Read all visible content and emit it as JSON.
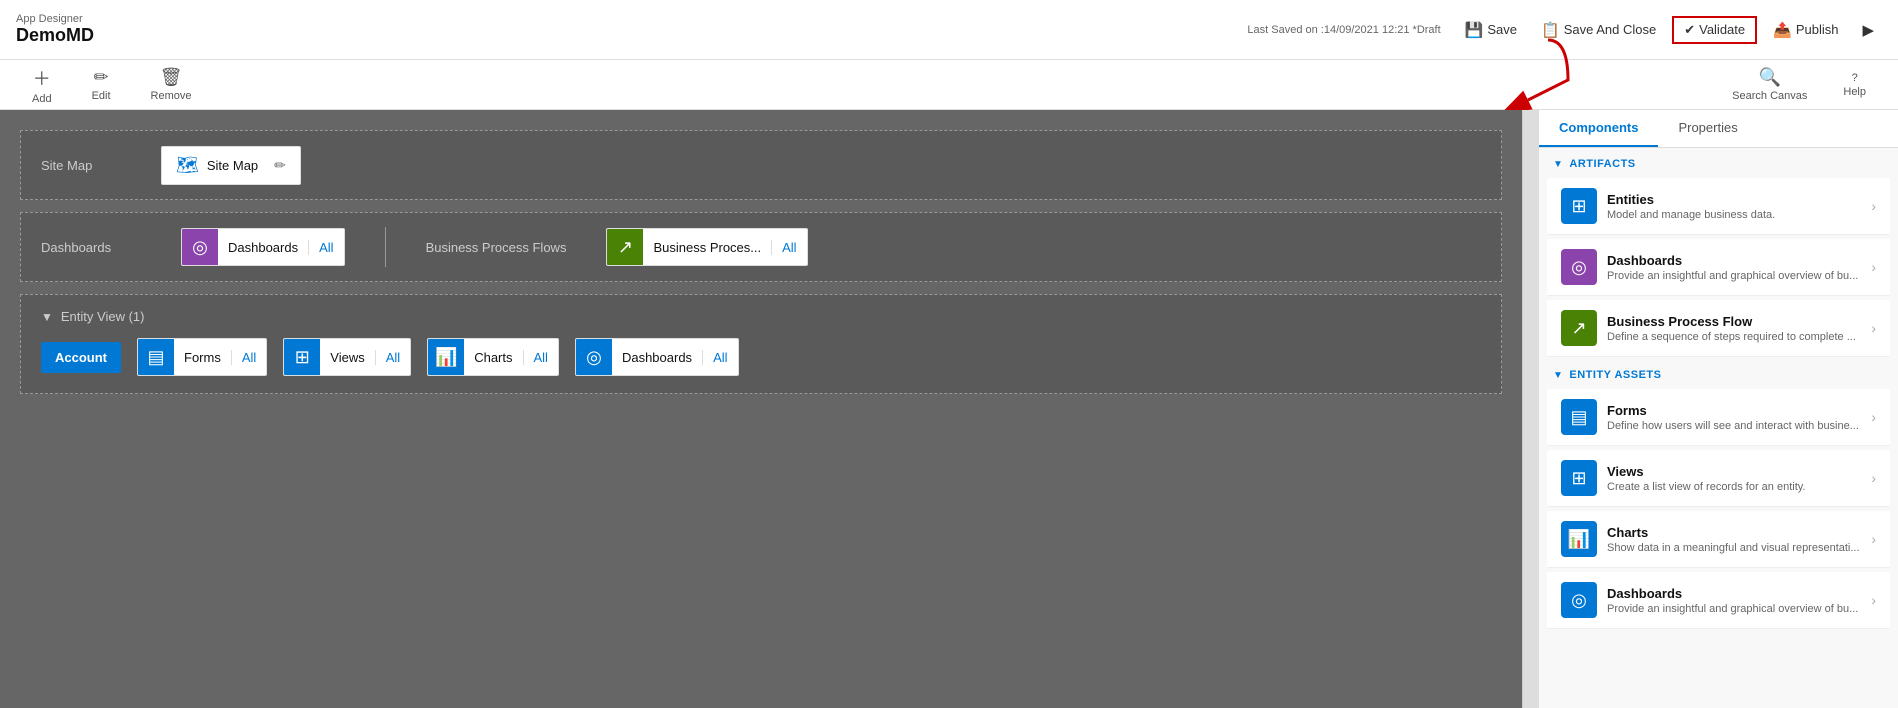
{
  "app": {
    "designer_label": "App Designer",
    "app_name": "DemoMD"
  },
  "header": {
    "last_saved": "Last Saved on :14/09/2021 12:21 *Draft",
    "save_label": "Save",
    "save_close_label": "Save And Close",
    "validate_label": "Validate",
    "publish_label": "Publish",
    "play_label": "Play"
  },
  "secondary_toolbar": {
    "add_label": "Add",
    "edit_label": "Edit",
    "remove_label": "Remove",
    "search_canvas_label": "Search Canvas",
    "help_label": "Help"
  },
  "canvas": {
    "sitemap": {
      "label": "Site Map",
      "box_label": "Site Map",
      "edit_tooltip": "Edit"
    },
    "dashboards": {
      "label": "Dashboards",
      "box_label": "Dashboards",
      "all_label": "All"
    },
    "bpf": {
      "label": "Business Process Flows",
      "box_label": "Business Proces...",
      "all_label": "All"
    },
    "entity_view": {
      "label": "Entity View (1)",
      "entity_name": "Account"
    },
    "forms": {
      "label": "Forms",
      "all_label": "All"
    },
    "views": {
      "label": "Views",
      "all_label": "All"
    },
    "charts": {
      "label": "Charts",
      "all_label": "All"
    },
    "entity_dashboards": {
      "label": "Dashboards",
      "all_label": "All"
    }
  },
  "right_panel": {
    "tabs": [
      {
        "label": "Components",
        "active": true
      },
      {
        "label": "Properties",
        "active": false
      }
    ],
    "artifacts_header": "ARTIFACTS",
    "entity_assets_header": "ENTITY ASSETS",
    "artifacts": [
      {
        "id": "entities",
        "title": "Entities",
        "desc": "Model and manage business data.",
        "icon_type": "blue",
        "icon": "⊞"
      },
      {
        "id": "dashboards",
        "title": "Dashboards",
        "desc": "Provide an insightful and graphical overview of bu...",
        "icon_type": "purple",
        "icon": "◎"
      },
      {
        "id": "bpf",
        "title": "Business Process Flow",
        "desc": "Define a sequence of steps required to complete ...",
        "icon_type": "green",
        "icon": "↗"
      }
    ],
    "entity_assets": [
      {
        "id": "forms",
        "title": "Forms",
        "desc": "Define how users will see and interact with busine...",
        "icon_type": "blue",
        "icon": "▤"
      },
      {
        "id": "views",
        "title": "Views",
        "desc": "Create a list view of records for an entity.",
        "icon_type": "blue",
        "icon": "⊞"
      },
      {
        "id": "charts",
        "title": "Charts",
        "desc": "Show data in a meaningful and visual representati...",
        "icon_type": "blue",
        "icon": "▦"
      },
      {
        "id": "dashboards2",
        "title": "Dashboards",
        "desc": "Provide an insightful and graphical overview of bu...",
        "icon_type": "blue",
        "icon": "◎"
      }
    ]
  }
}
